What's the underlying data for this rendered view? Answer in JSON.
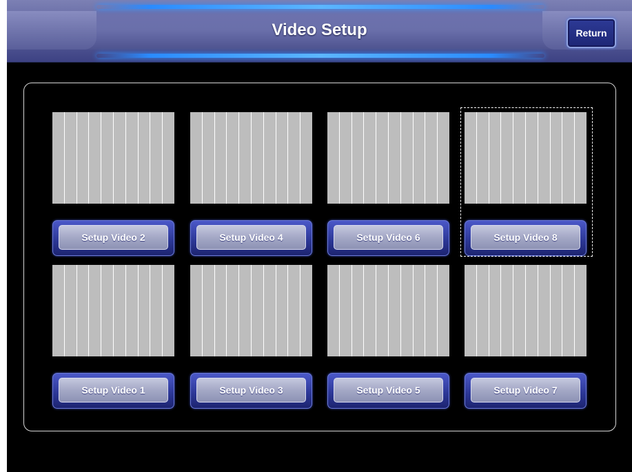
{
  "header": {
    "title": "Video Setup",
    "return_label": "Return"
  },
  "grid": {
    "top_row": [
      {
        "label": "Setup Video 2"
      },
      {
        "label": "Setup Video 4"
      },
      {
        "label": "Setup Video 6"
      },
      {
        "label": "Setup Video 8",
        "focused": true
      }
    ],
    "bottom_row": [
      {
        "label": "Setup Video 1"
      },
      {
        "label": "Setup Video 3"
      },
      {
        "label": "Setup Video 5"
      },
      {
        "label": "Setup Video 7"
      }
    ]
  },
  "colors": {
    "background": "#000000",
    "header": "#6a6faa",
    "glow": "#2a8bff",
    "preview_stripe": "#bdbdbd",
    "button_face": "#a4a8c6"
  }
}
